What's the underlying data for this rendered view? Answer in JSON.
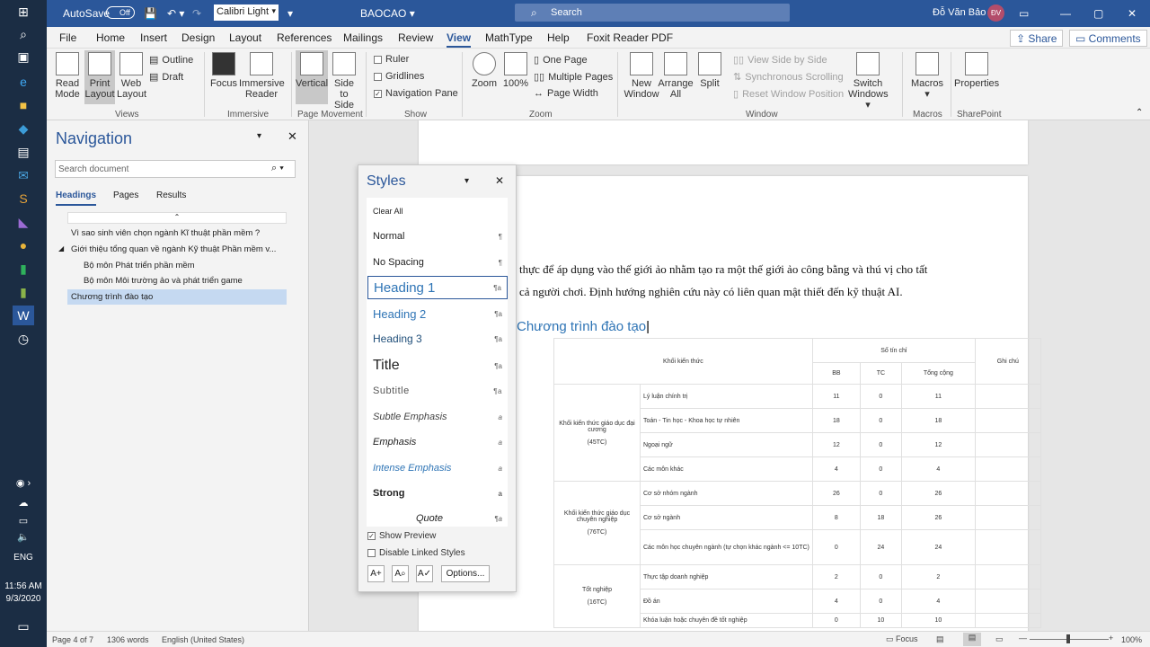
{
  "taskbar": {
    "lang": "ENG",
    "time": "11:56 AM",
    "date": "9/3/2020"
  },
  "titlebar": {
    "autosave": "AutoSave",
    "toggle": "Off",
    "font": "Calibri Light",
    "doc": "BAOCAO",
    "search": "Search",
    "user": "Đỗ Văn Bảo",
    "initials": "ĐV"
  },
  "tabs": [
    "File",
    "Home",
    "Insert",
    "Design",
    "Layout",
    "References",
    "Mailings",
    "Review",
    "View",
    "MathType",
    "Help",
    "Foxit Reader PDF"
  ],
  "share": "Share",
  "comments": "Comments",
  "ribbon": {
    "views": {
      "read": "Read Mode",
      "print": "Print Layout",
      "web": "Web Layout",
      "outline": "Outline",
      "draft": "Draft",
      "label": "Views"
    },
    "immersive": {
      "focus": "Focus",
      "reader": "Immersive Reader",
      "label": "Immersive"
    },
    "movement": {
      "vertical": "Vertical",
      "side": "Side to Side",
      "label": "Page Movement"
    },
    "show": {
      "ruler": "Ruler",
      "gridlines": "Gridlines",
      "navpane": "Navigation Pane",
      "label": "Show"
    },
    "zoom": {
      "zoom": "Zoom",
      "pct": "100%",
      "one": "One Page",
      "multi": "Multiple Pages",
      "width": "Page Width",
      "label": "Zoom"
    },
    "window": {
      "new": "New Window",
      "arrange": "Arrange All",
      "split": "Split",
      "sbs": "View Side by Side",
      "sync": "Synchronous Scrolling",
      "reset": "Reset Window Position",
      "switch": "Switch Windows",
      "label": "Window"
    },
    "macros": {
      "macros": "Macros",
      "label": "Macros"
    },
    "sp": {
      "props": "Properties",
      "label": "SharePoint"
    }
  },
  "nav": {
    "title": "Navigation",
    "search": "Search document",
    "tabs": [
      "Headings",
      "Pages",
      "Results"
    ],
    "items": [
      "Vì sao sinh viên chọn ngành Kĩ thuật phần mềm ?",
      "Giới thiệu tổng quan về ngành Kỹ thuật Phần mềm v...",
      "Bộ môn Phát triển phần mềm",
      "Bộ môn Môi trường ảo và phát triển game",
      "Chương trình đào tạo"
    ]
  },
  "styles": {
    "title": "Styles",
    "items": [
      "Clear All",
      "Normal",
      "No Spacing",
      "Heading 1",
      "Heading 2",
      "Heading 3",
      "Title",
      "Subtitle",
      "Subtle Emphasis",
      "Emphasis",
      "Intense Emphasis",
      "Strong",
      "Quote"
    ],
    "preview": "Show Preview",
    "linked": "Disable Linked Styles",
    "options": "Options..."
  },
  "doc": {
    "line1": "thực để áp dụng vào thế giới ảo nhằm tạo ra một thế giới ảo công bằng và thú vị cho tất",
    "line2": "cả người chơi. Định hướng nghiên cứu này có liên quan mật thiết đến kỹ thuật AI.",
    "heading": "Chương trình đào tạo",
    "table": {
      "h_kkt": "Khối kiến thức",
      "h_stc": "Số tín chỉ",
      "h_gc": "Ghi chú",
      "h_bb": "BB",
      "h_tc": "TC",
      "h_tong": "Tổng cộng",
      "g1": "Khối kiến thức giáo dục đại cương",
      "g1c": "(45TC)",
      "g2": "Khối kiến thức giáo dục chuyên nghiệp",
      "g2c": "(76TC)",
      "g3": "Tốt nghiệp",
      "g3c": "(16TC)",
      "rows": [
        [
          "Lý luận chính trị",
          "11",
          "0",
          "11"
        ],
        [
          "Toán - Tin học - Khoa học tự nhiên",
          "18",
          "0",
          "18"
        ],
        [
          "Ngoại ngữ",
          "12",
          "0",
          "12"
        ],
        [
          "Các môn khác",
          "4",
          "0",
          "4"
        ],
        [
          "Cơ sở nhóm ngành",
          "26",
          "0",
          "26"
        ],
        [
          "Cơ sở ngành",
          "8",
          "18",
          "26"
        ],
        [
          "Các môn học chuyên ngành (tự chọn khác ngành <= 10TC)",
          "0",
          "24",
          "24"
        ],
        [
          "Thực tập doanh nghiệp",
          "2",
          "0",
          "2"
        ],
        [
          "Đồ án",
          "4",
          "0",
          "4"
        ],
        [
          "Khóa luận hoặc chuyên đề tốt nghiệp",
          "0",
          "10",
          "10"
        ]
      ]
    }
  },
  "status": {
    "page": "Page 4 of 7",
    "words": "1306 words",
    "lang": "English (United States)",
    "focus": "Focus",
    "zoom": "100%"
  }
}
